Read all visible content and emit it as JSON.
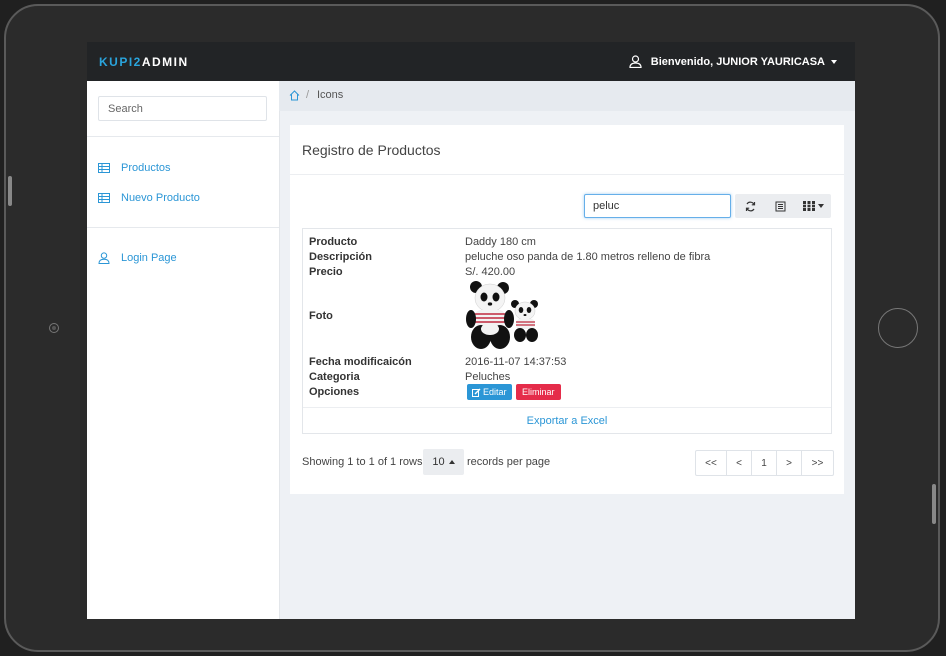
{
  "header": {
    "brand_part1": "KUPI2",
    "brand_part2": "ADMIN",
    "welcome": "Bienvenido, JUNIOR YAURICASA"
  },
  "sidebar": {
    "search_placeholder": "Search",
    "items": [
      {
        "label": "Productos",
        "icon": "table-icon"
      },
      {
        "label": "Nuevo Producto",
        "icon": "table-icon"
      },
      {
        "label": "Login Page",
        "icon": "user-icon"
      }
    ]
  },
  "breadcrumb": {
    "current": "Icons"
  },
  "panel": {
    "title": "Registro de Productos",
    "filter_value": "peluc"
  },
  "product": {
    "labels": {
      "producto": "Producto",
      "descripcion": "Descripción",
      "precio": "Precio",
      "foto": "Foto",
      "fecha": "Fecha modificaicón",
      "categoria": "Categoria",
      "opciones": "Opciones"
    },
    "values": {
      "producto": "Daddy 180 cm",
      "descripcion": "peluche oso panda de 1.80 metros relleno de fibra",
      "precio": "S/. 420.00",
      "fecha": "2016-11-07 14:37:53",
      "categoria": "Peluches"
    },
    "edit_label": "Editar",
    "delete_label": "Eliminar"
  },
  "export_label": "Exportar a Excel",
  "pagination": {
    "showing": "Showing 1 to 1 of 1 rows",
    "per_page": "10",
    "records_label": "records per page",
    "first": "<<",
    "prev": "<",
    "page": "1",
    "next": ">",
    "last": ">>"
  },
  "colors": {
    "accent": "#2b96d6",
    "danger": "#e52c4a",
    "topbar": "#222426"
  }
}
